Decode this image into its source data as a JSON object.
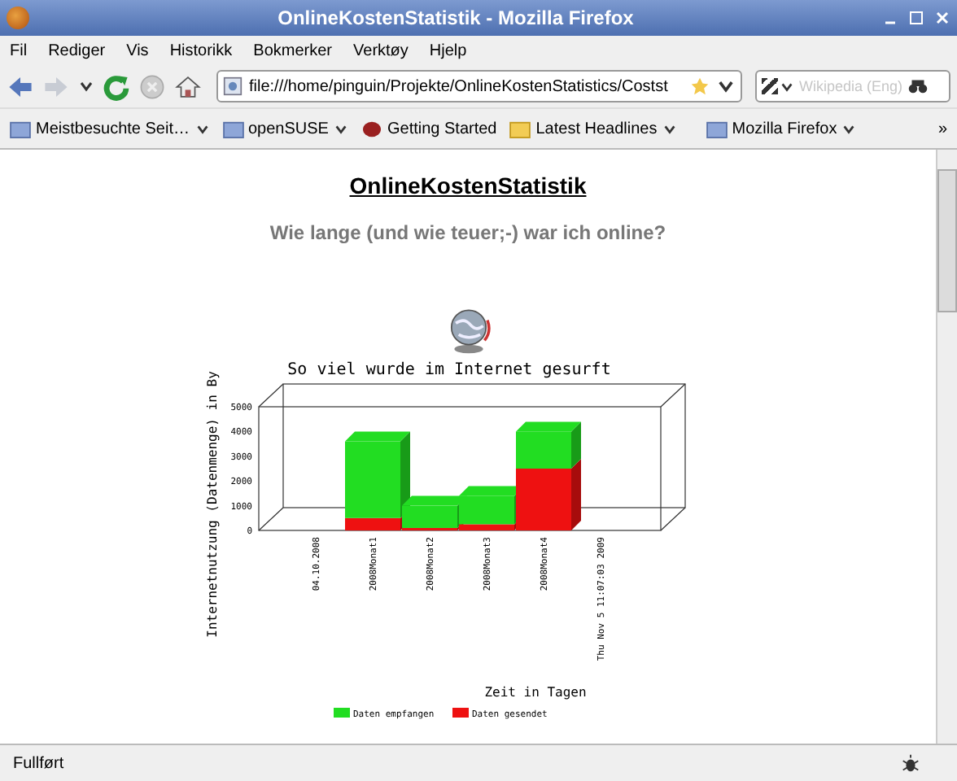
{
  "window": {
    "title": "OnlineKostenStatistik - Mozilla Firefox"
  },
  "menu": [
    "Fil",
    "Rediger",
    "Vis",
    "Historikk",
    "Bokmerker",
    "Verktøy",
    "Hjelp"
  ],
  "address": {
    "value": "file:///home/pinguin/Projekte/OnlineKostenStatistics/Costst"
  },
  "search": {
    "placeholder": "Wikipedia (Eng)"
  },
  "bookmarks": [
    {
      "label": "Meistbesuchte Seit…",
      "kind": "folder-menu"
    },
    {
      "label": "openSUSE",
      "kind": "folder-menu"
    },
    {
      "label": "Getting Started",
      "kind": "page"
    },
    {
      "label": "Latest Headlines",
      "kind": "feed-menu"
    },
    {
      "label": "Mozilla Firefox",
      "kind": "folder-menu"
    }
  ],
  "more": "»",
  "page": {
    "heading": "OnlineKostenStatistik",
    "subtitle": "Wie lange (und wie teuer;-) war ich online?",
    "chart_data": {
      "type": "bar",
      "stacked": true,
      "title": "So viel wurde im Internet gesurft",
      "xlabel": "Zeit in Tagen",
      "ylabel": "Internetnutzung (Datenmenge) in By",
      "categories": [
        "04.10.2008",
        "2008Monat1",
        "2008Monat2",
        "2008Monat3",
        "2008Monat4",
        "Thu Nov  5 11:07:03 2009"
      ],
      "series": [
        {
          "name": "Daten gesendet",
          "color": "#ee1111",
          "values": [
            null,
            500,
            100,
            250,
            2500,
            null
          ]
        },
        {
          "name": "Daten empfangen",
          "color": "#22dd22",
          "values": [
            null,
            3100,
            900,
            1150,
            1500,
            null
          ]
        }
      ],
      "legend": true,
      "ylim": [
        0,
        5000
      ],
      "yticks": [
        0,
        1000,
        2000,
        3000,
        4000,
        5000
      ]
    }
  },
  "status_bar": {
    "text": "Fullført"
  }
}
